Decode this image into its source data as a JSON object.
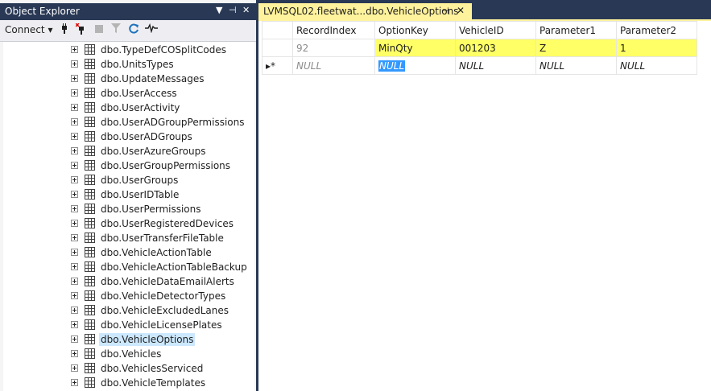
{
  "object_explorer": {
    "title": "Object Explorer",
    "title_buttons": {
      "dropdown": "▼",
      "pin": "⊣",
      "close": "✕"
    },
    "toolbar": {
      "connect_label": "Connect",
      "connect_arrow": "▾",
      "icons": [
        "plug-icon",
        "disconnect-icon",
        "stop-icon",
        "filter-icon",
        "refresh-icon",
        "activity-monitor-icon"
      ]
    },
    "tree_items": [
      "dbo.TypeDefCOSplitCodes",
      "dbo.UnitsTypes",
      "dbo.UpdateMessages",
      "dbo.UserAccess",
      "dbo.UserActivity",
      "dbo.UserADGroupPermissions",
      "dbo.UserADGroups",
      "dbo.UserAzureGroups",
      "dbo.UserGroupPermissions",
      "dbo.UserGroups",
      "dbo.UserIDTable",
      "dbo.UserPermissions",
      "dbo.UserRegisteredDevices",
      "dbo.UserTransferFileTable",
      "dbo.VehicleActionTable",
      "dbo.VehicleActionTableBackup",
      "dbo.VehicleDataEmailAlerts",
      "dbo.VehicleDetectorTypes",
      "dbo.VehicleExcludedLanes",
      "dbo.VehicleLicensePlates",
      "dbo.VehicleOptions",
      "dbo.Vehicles",
      "dbo.VehiclesServiced",
      "dbo.VehicleTemplates"
    ],
    "selected_item": "dbo.VehicleOptions"
  },
  "document_tab": {
    "title": "LVMSQL02.fleetwat...dbo.VehicleOptions",
    "pin": "⊣",
    "close": "✕"
  },
  "grid": {
    "columns": [
      "RecordIndex",
      "OptionKey",
      "VehicleID",
      "Parameter1",
      "Parameter2"
    ],
    "rows": [
      {
        "indicator": "",
        "cells": [
          "92",
          "MinQty",
          "001203",
          "Z",
          "1"
        ]
      },
      {
        "indicator": "▸*",
        "cells": [
          "NULL",
          "NULL",
          "NULL",
          "NULL",
          "NULL"
        ]
      }
    ]
  },
  "colors": {
    "chrome": "#293955",
    "tab_active": "#fff29d",
    "row_highlight": "#ffff66",
    "null_selection": "#3399ff"
  }
}
